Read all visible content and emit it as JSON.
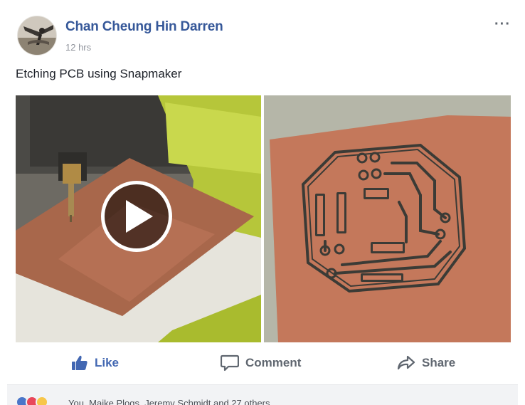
{
  "post": {
    "author": "Chan Cheung Hin Darren",
    "timestamp": "12 hrs",
    "text": "Etching PCB using Snapmaker",
    "more_label": "···"
  },
  "media": {
    "left_icon": "video-thumbnail",
    "right_icon": "photo-thumbnail",
    "play_icon": "play-icon"
  },
  "actions": {
    "like_label": "Like",
    "comment_label": "Comment",
    "share_label": "Share",
    "like_color": "#4267b2",
    "default_color": "#606770"
  },
  "reactions": {
    "icons": [
      "like-reaction-icon",
      "love-reaction-icon",
      "haha-reaction-icon"
    ],
    "summary": "You, Maike Plogs, Jeremy Schmidt and 27 others"
  },
  "colors": {
    "author_link": "#365899",
    "copper": "#c6775c"
  }
}
